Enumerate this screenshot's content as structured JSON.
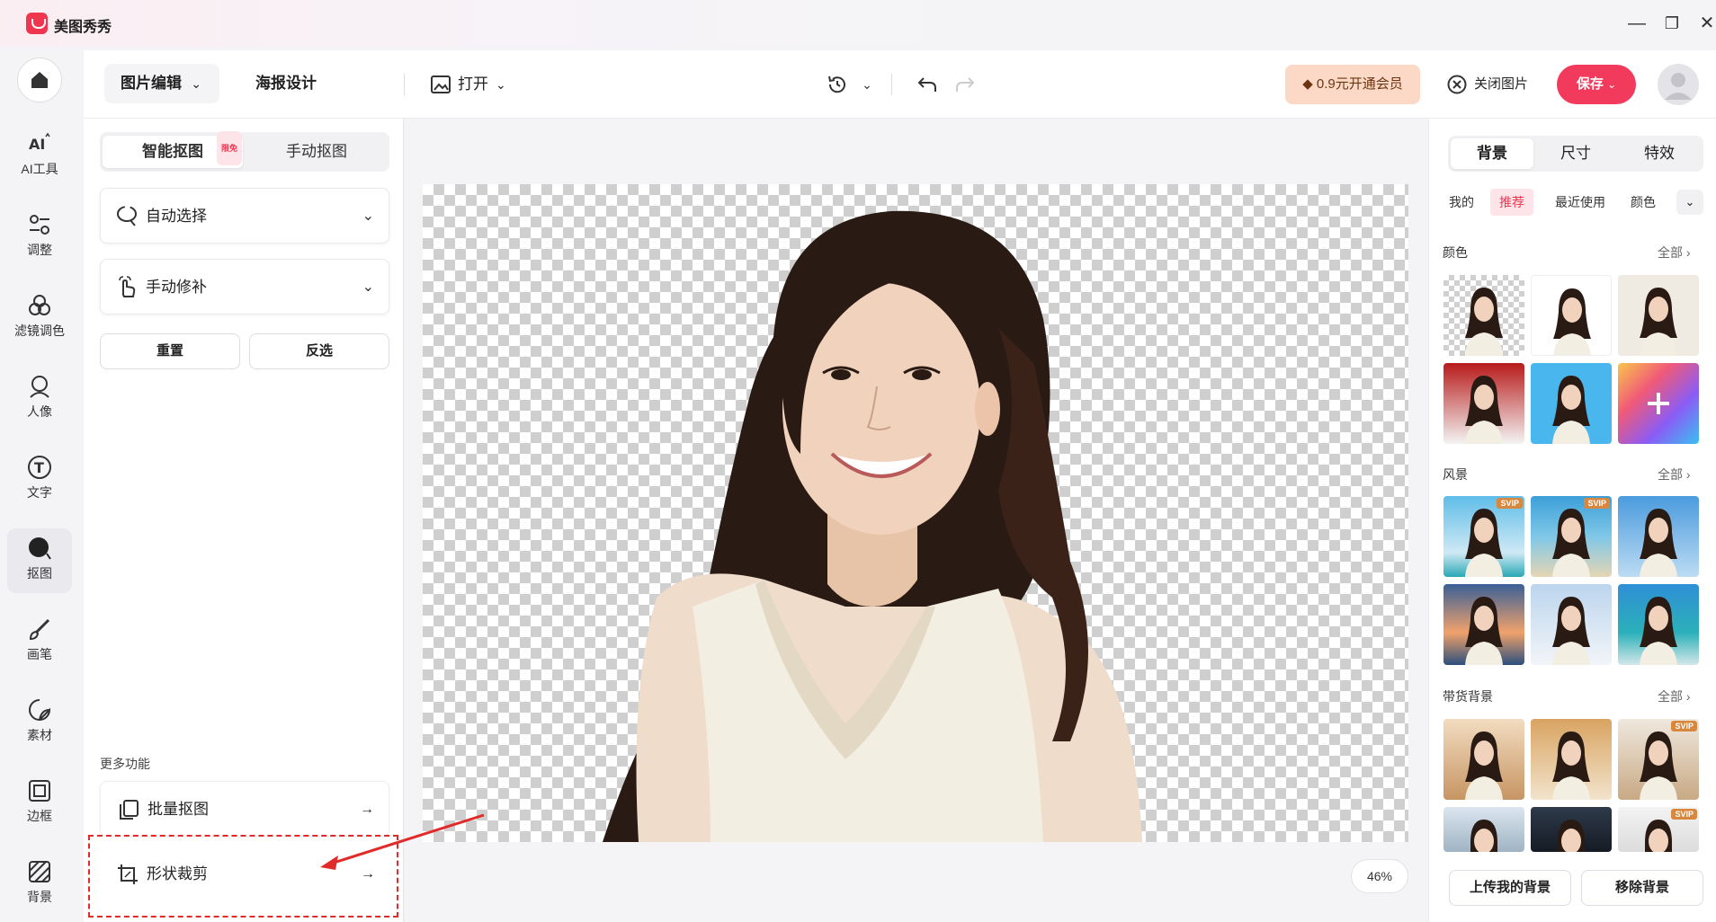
{
  "app": {
    "name": "美图秀秀"
  },
  "window_controls": {
    "minimize": "—",
    "restore": "❐",
    "close": "✕"
  },
  "rail": [
    {
      "label": "AI工具",
      "icon": "ai-icon"
    },
    {
      "label": "调整",
      "icon": "adjust-icon"
    },
    {
      "label": "滤镜调色",
      "icon": "filter-icon"
    },
    {
      "label": "人像",
      "icon": "portrait-icon"
    },
    {
      "label": "文字",
      "icon": "text-icon"
    },
    {
      "label": "抠图",
      "icon": "cutout-icon",
      "active": true
    },
    {
      "label": "画笔",
      "icon": "brush-icon"
    },
    {
      "label": "素材",
      "icon": "sticker-icon"
    },
    {
      "label": "边框",
      "icon": "frame-icon"
    },
    {
      "label": "背景",
      "icon": "background-icon"
    }
  ],
  "topbar": {
    "tab_edit": "图片编辑",
    "tab_poster": "海报设计",
    "open": "打开",
    "vip": "0.9元开通会员",
    "close_image": "关闭图片",
    "save": "保存"
  },
  "left_panel": {
    "seg_smart": "智能抠图",
    "seg_badge": "限免",
    "seg_manual": "手动抠图",
    "auto_select": "自动选择",
    "manual_fix": "手动修补",
    "reset": "重置",
    "invert": "反选",
    "more_title": "更多功能",
    "batch": "批量抠图",
    "shape_crop": "形状裁剪"
  },
  "canvas": {
    "zoom": "46%"
  },
  "right_panel": {
    "tabs": [
      "背景",
      "尺寸",
      "特效"
    ],
    "chips": [
      "我的",
      "推荐",
      "最近使用",
      "颜色"
    ],
    "color_title": "颜色",
    "scenery_title": "风景",
    "product_title": "带货背景",
    "all": "全部",
    "svip": "SVIP",
    "upload": "上传我的背景",
    "remove": "移除背景"
  },
  "colors": {
    "accent": "#f23a5c",
    "vip_bg": "#fcd9c6",
    "annotation": "#e12b2b"
  }
}
